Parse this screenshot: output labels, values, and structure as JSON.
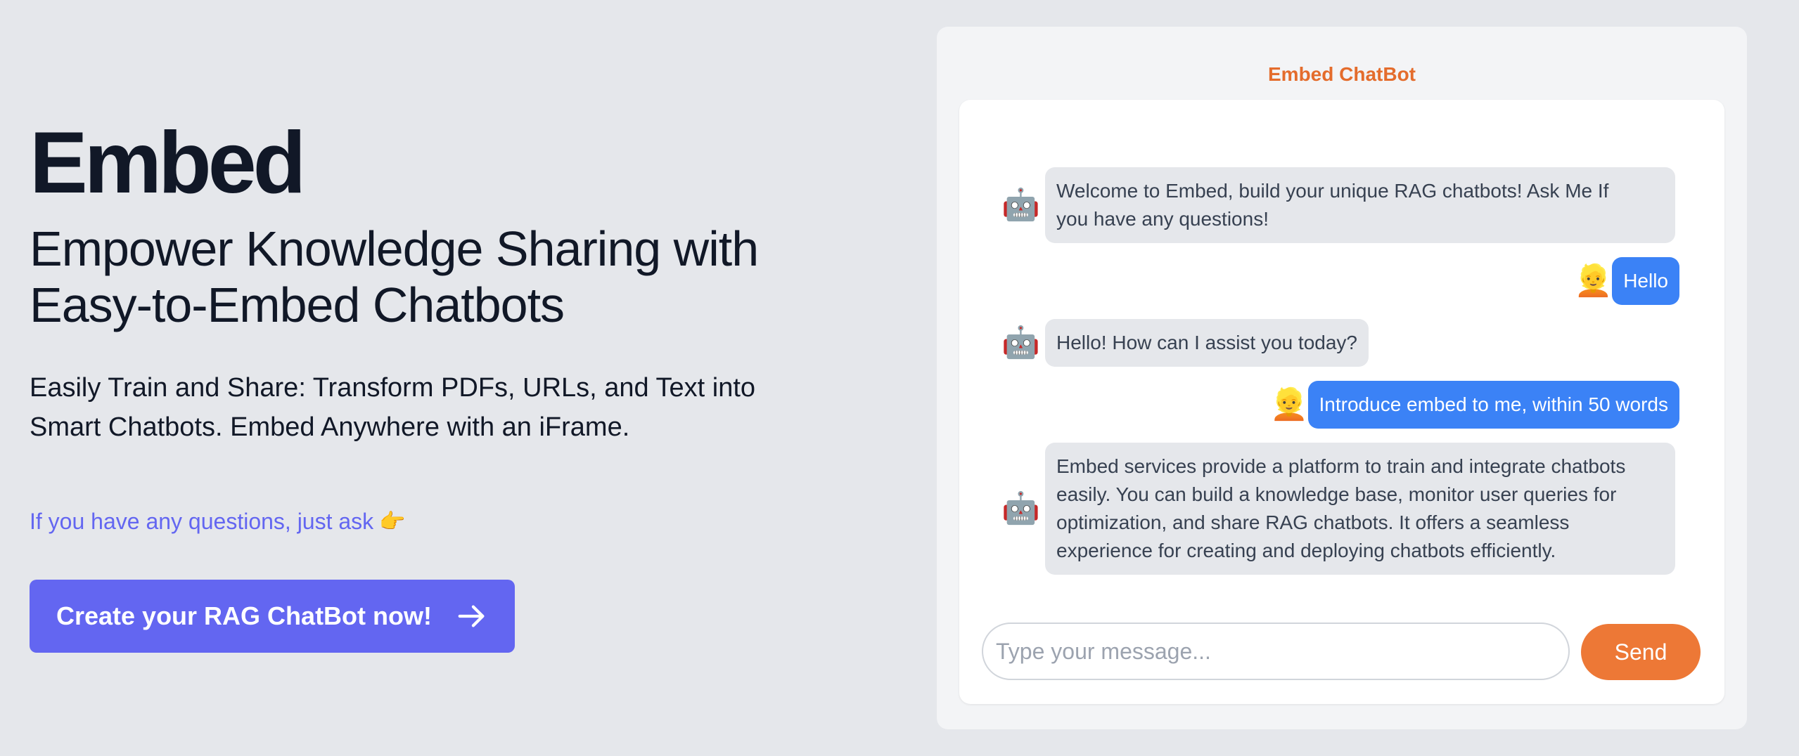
{
  "hero": {
    "brand": "Embed",
    "tagline_line1": "Empower Knowledge Sharing with",
    "tagline_line2": "Easy-to-Embed Chatbots",
    "desc_line1": "Easily Train and Share: Transform PDFs, URLs, and Text into",
    "desc_line2": "Smart Chatbots. Embed Anywhere with an iFrame.",
    "ask_text": "If you have any questions, just ask",
    "ask_icon": "👉",
    "cta_label": "Create your RAG ChatBot now!"
  },
  "chat": {
    "title": "Embed ChatBot",
    "bot_avatar": "🤖",
    "user_avatar": "👱",
    "messages": [
      {
        "role": "bot",
        "text_line1": "Welcome to Embed, build your unique RAG chatbots!   Ask Me If",
        "text_line2": "you have any questions!"
      },
      {
        "role": "user",
        "text": "Hello"
      },
      {
        "role": "bot",
        "text": "Hello! How can I assist you today?"
      },
      {
        "role": "user",
        "text": "Introduce embed to me, within 50 words"
      },
      {
        "role": "bot",
        "text_line1": "Embed services provide a platform to train and integrate chatbots",
        "text_line2": "easily. You can build a knowledge base, monitor user queries for",
        "text_line3": "optimization, and share RAG chatbots. It offers a seamless",
        "text_line4": "experience for creating and deploying chatbots efficiently."
      }
    ],
    "input_placeholder": "Type your message...",
    "input_value": "",
    "send_label": "Send"
  },
  "colors": {
    "background": "#e5e7eb",
    "accent_indigo": "#6366f1",
    "accent_orange": "#ed7836",
    "user_bubble": "#3b82f6",
    "bot_bubble": "#e5e7eb"
  }
}
